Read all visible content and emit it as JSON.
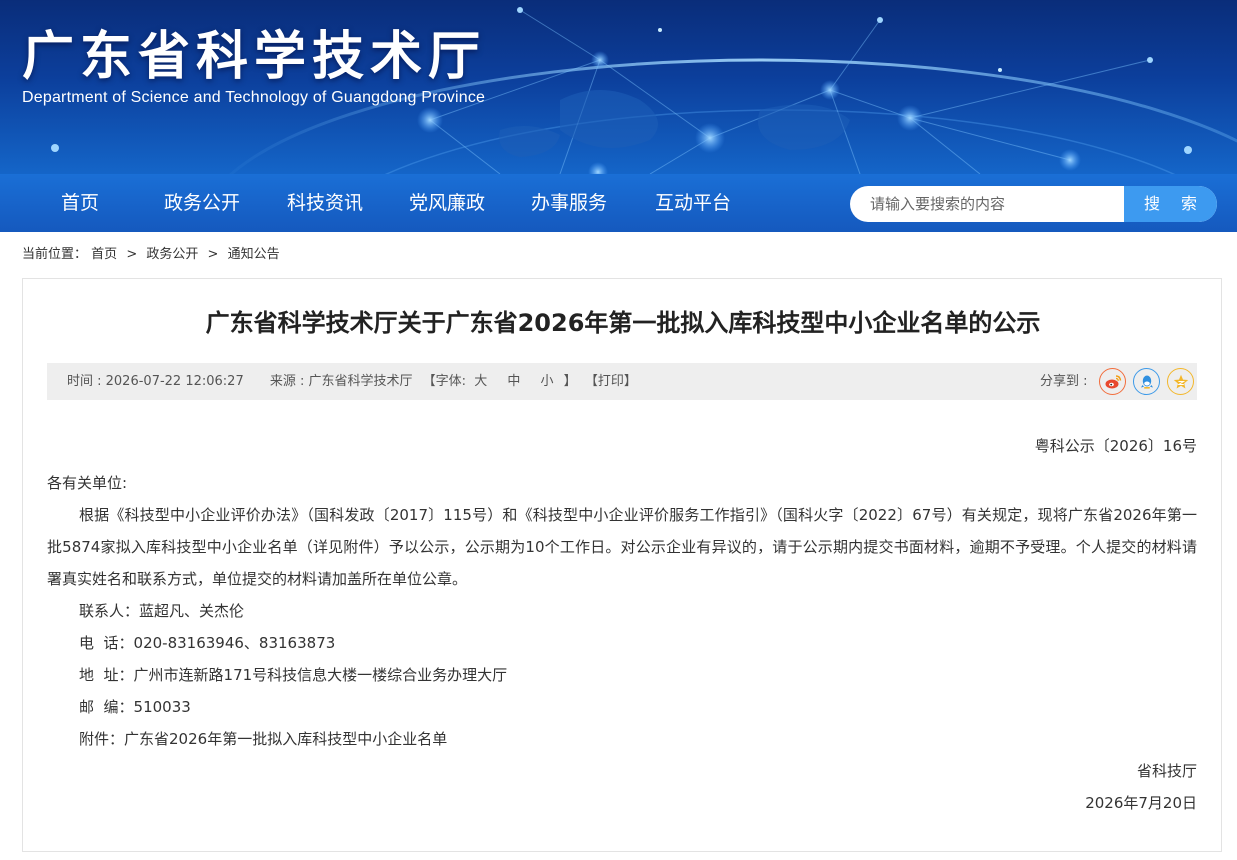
{
  "header": {
    "site_title": "广东省科学技术厅",
    "site_subtitle": "Department of Science and Technology of Guangdong Province"
  },
  "nav": {
    "items": [
      {
        "label": "首页"
      },
      {
        "label": "政务公开"
      },
      {
        "label": "科技资讯"
      },
      {
        "label": "党风廉政"
      },
      {
        "label": "办事服务"
      },
      {
        "label": "互动平台"
      }
    ],
    "search": {
      "placeholder": "请输入要搜索的内容",
      "button_label": "搜 索"
    }
  },
  "breadcrumb": {
    "prefix": "当前位置：",
    "items": [
      "首页",
      "政务公开",
      "通知公告"
    ],
    "separator": ">"
  },
  "article": {
    "title": "广东省科学技术厅关于广东省2026年第一批拟入库科技型中小企业名单的公示",
    "meta": {
      "time": "时间 : 2026-07-22 12:06:27",
      "source": "来源 : 广东省科学技术厅",
      "font_prefix": "【字体:",
      "font_large": "大",
      "font_medium": "中",
      "font_small": "小",
      "font_suffix": "】",
      "print": "【打印】",
      "share_label": "分享到 :",
      "share_icons": [
        "weibo-icon",
        "qq-icon",
        "qzone-icon"
      ],
      "share_colors": {
        "weibo": "#f26d3c",
        "qq": "#3d9ae8",
        "qzone": "#f3b72b"
      }
    },
    "doc_number": "粤科公示〔2026〕16号",
    "salutation": "各有关单位:",
    "paragraph": "根据《科技型中小企业评价办法》（国科发政〔2017〕115号）和《科技型中小企业评价服务工作指引》（国科火字〔2022〕67号）有关规定，现将广东省2026年第一批5874家拟入库科技型中小企业名单（详见附件）予以公示，公示期为10个工作日。对公示企业有异议的，请于公示期内提交书面材料，逾期不予受理。个人提交的材料请署真实姓名和联系方式，单位提交的材料请加盖所在单位公章。",
    "contact": "联系人：蓝超凡、关杰伦",
    "phone": "电  话：020-83163946、83163873",
    "address": "地  址：广州市连新路171号科技信息大楼一楼综合业务办理大厅",
    "postcode": "邮  编：510033",
    "attachment_prefix": "附件：",
    "attachment_link": "广东省2026年第一批拟入库科技型中小企业名单",
    "signature": "省科技厅",
    "date": "2026年7月20日"
  }
}
